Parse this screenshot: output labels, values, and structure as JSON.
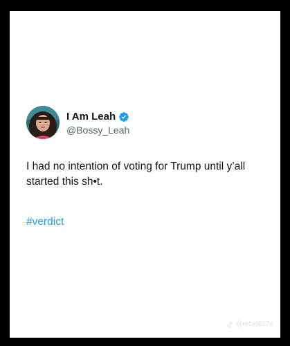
{
  "tweet": {
    "display_name": "I Am Leah",
    "handle": "@Bossy_Leah",
    "verified_icon": "verified-badge-icon",
    "text": "I had no intention of voting for Trump until y’all started this sh•t.",
    "hashtag": "#verdict"
  },
  "watermark": {
    "text": "@rebel627a",
    "icon": "tiktok-icon"
  },
  "colors": {
    "background": "#000000",
    "card": "#ffffff",
    "text": "#0f1419",
    "secondary": "#536471",
    "accent": "#1d9bf0"
  }
}
